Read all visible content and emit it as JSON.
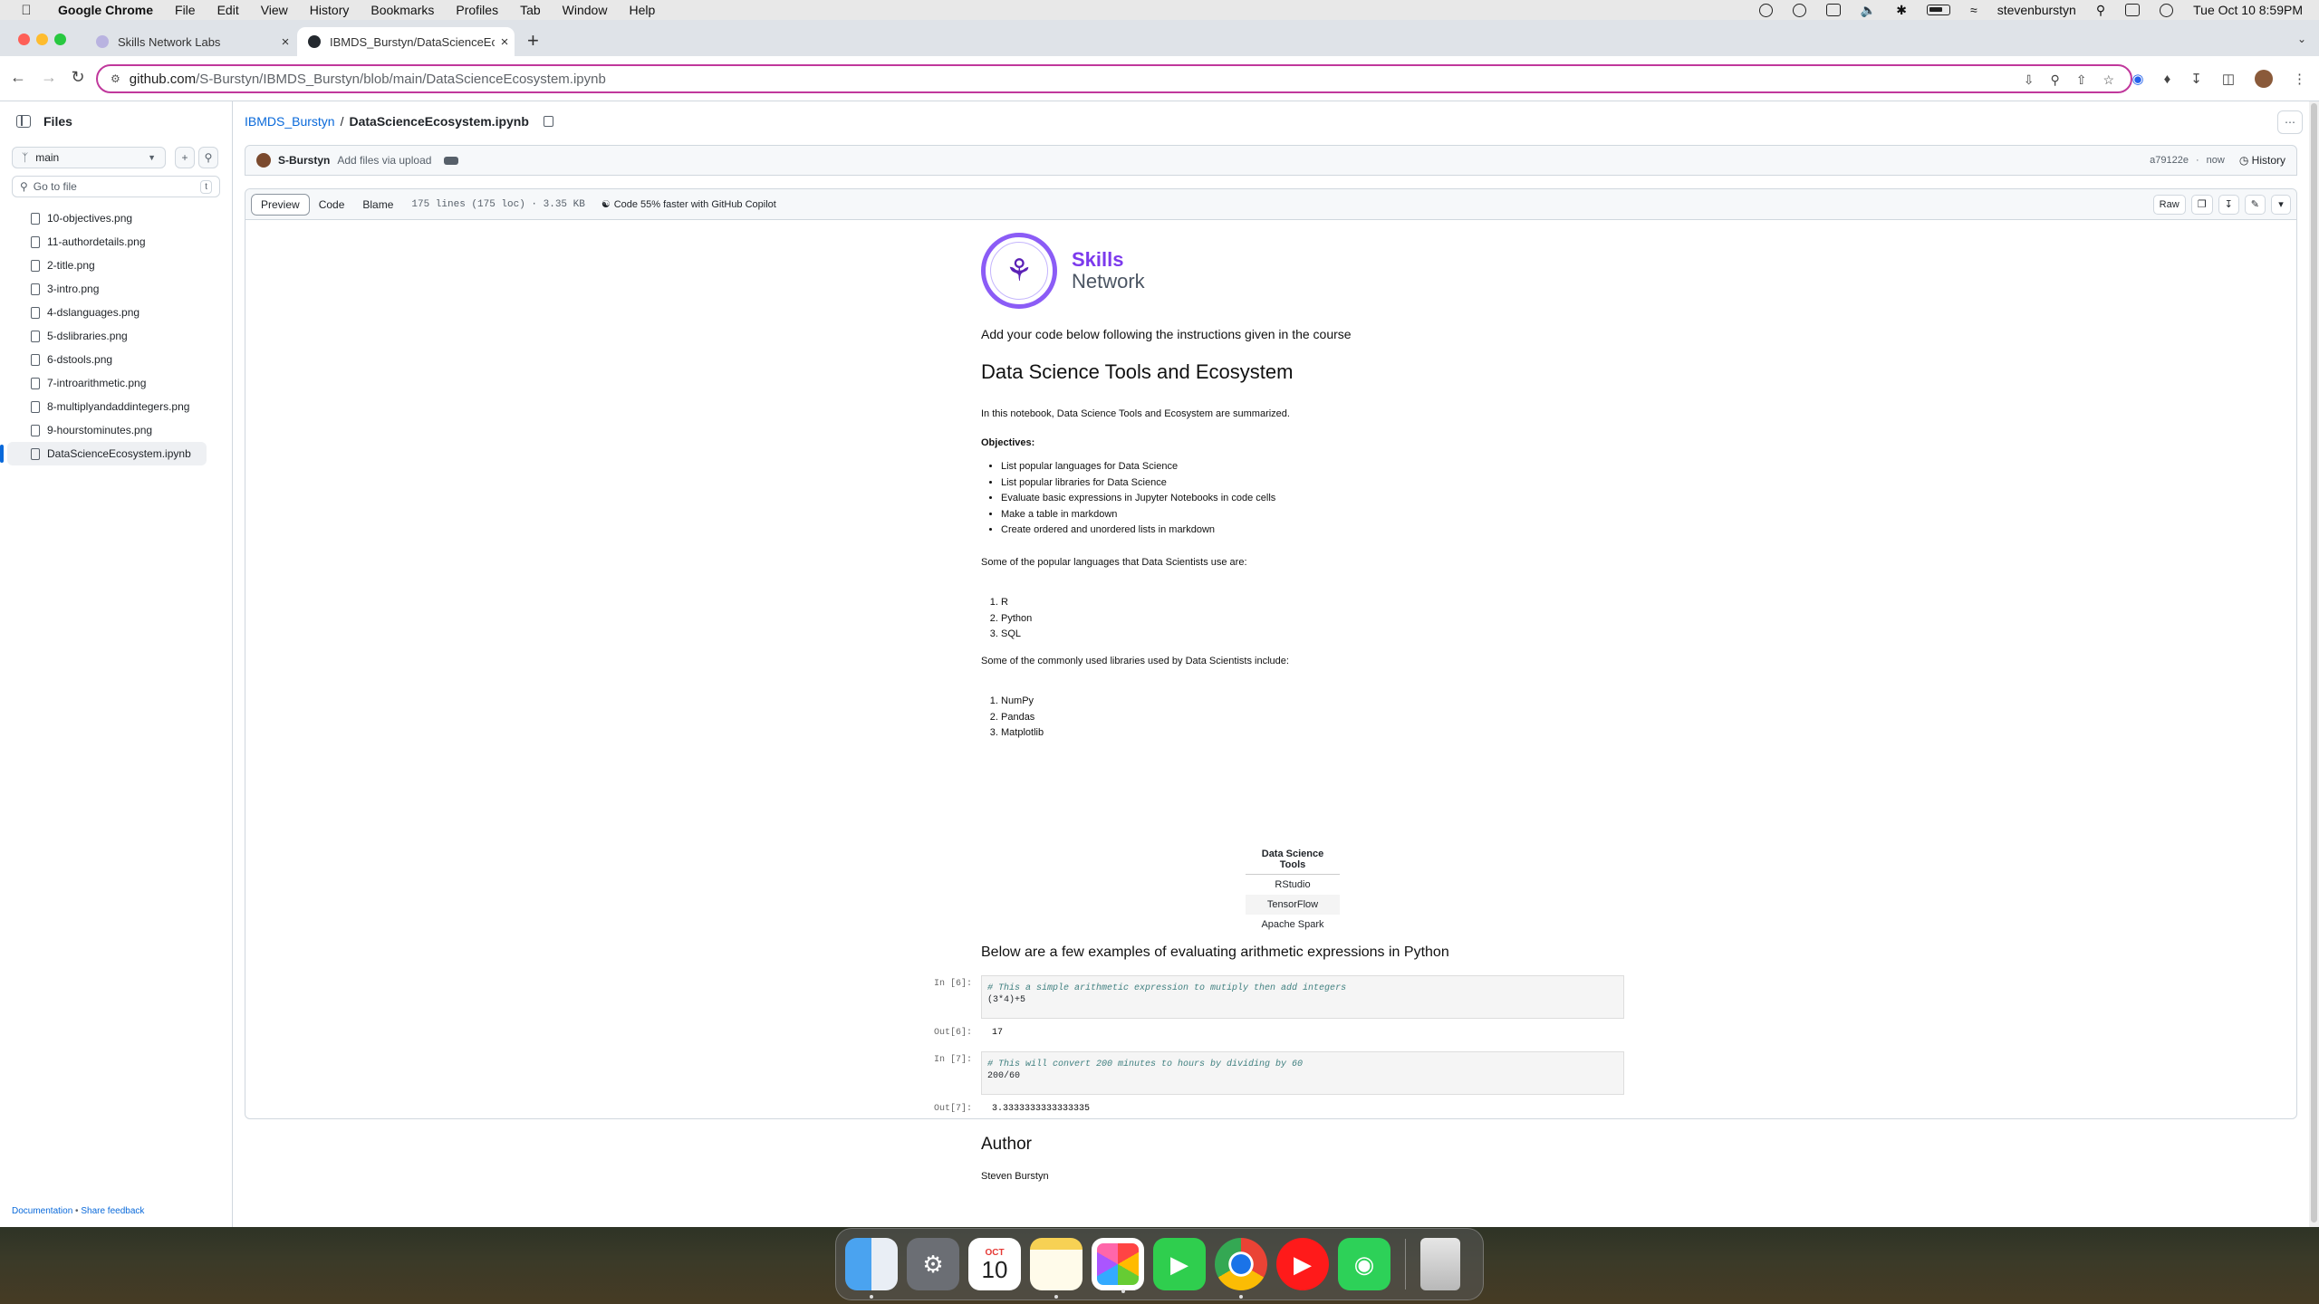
{
  "menubar": {
    "app": "Google Chrome",
    "items": [
      "File",
      "Edit",
      "View",
      "History",
      "Bookmarks",
      "Profiles",
      "Tab",
      "Window",
      "Help"
    ],
    "user": "stevenburstyn",
    "datetime": "Tue Oct 10  8:59PM"
  },
  "browser": {
    "tabs": [
      {
        "title": "Skills Network Labs",
        "active": false
      },
      {
        "title": "IBMDS_Burstyn/DataScienceEcosystem.ipynb",
        "active": true
      }
    ],
    "url_host": "github.com",
    "url_path": "/S-Burstyn/IBMDS_Burstyn/blob/main/DataScienceEcosystem.ipynb"
  },
  "sidebar": {
    "title": "Files",
    "branch": "main",
    "goto_placeholder": "Go to file",
    "goto_kbd": "t",
    "files": [
      "10-objectives.png",
      "11-authordetails.png",
      "2-title.png",
      "3-intro.png",
      "4-dslanguages.png",
      "5-dslibraries.png",
      "6-dstools.png",
      "7-introarithmetic.png",
      "8-multiplyandaddintegers.png",
      "9-hourstominutes.png",
      "DataScienceEcosystem.ipynb"
    ],
    "selected_file": "DataScienceEcosystem.ipynb",
    "footer_docs": "Documentation",
    "footer_sep": "•",
    "footer_feedback": "Share feedback"
  },
  "repo": {
    "owner_repo": "IBMDS_Burstyn",
    "separator": "/",
    "file": "DataScienceEcosystem.ipynb"
  },
  "commit": {
    "user": "S-Burstyn",
    "message": "Add files via upload",
    "hash": "a79122e",
    "sep": "·",
    "time": "now",
    "history": "History"
  },
  "filebar": {
    "tabs": [
      "Preview",
      "Code",
      "Blame"
    ],
    "active_tab": "Preview",
    "meta": "175 lines (175 loc) · 3.35 KB",
    "copilot": "Code 55% faster with GitHub Copilot",
    "raw": "Raw"
  },
  "notebook": {
    "logo_line1": "Skills",
    "logo_line2": "Network",
    "intro_instruction": "Add your code below following the instructions given in the course",
    "title": "Data Science Tools and Ecosystem",
    "summary": "In this notebook, Data Science Tools and Ecosystem are summarized.",
    "objectives_label": "Objectives:",
    "objectives": [
      "List popular languages for Data Science",
      "List popular libraries for Data Science",
      "Evaluate basic expressions in Jupyter Notebooks in code cells",
      "Make a table in markdown",
      "Create ordered and unordered lists in markdown"
    ],
    "languages_intro": "Some of the popular languages that Data Scientists use are:",
    "languages": [
      "R",
      "Python",
      "SQL"
    ],
    "libraries_intro": "Some of the commonly used libraries used by Data Scientists include:",
    "libraries": [
      "NumPy",
      "Pandas",
      "Matplotlib"
    ],
    "tools_header": "Data Science Tools",
    "tools": [
      "RStudio",
      "TensorFlow",
      "Apache Spark"
    ],
    "arith_heading": "Below are a few examples of evaluating arithmetic expressions in Python",
    "cells": [
      {
        "in_prompt": "In [6]:",
        "comment": "# This a simple arithmetic expression to mutiply then add integers",
        "code": "(3*4)+5",
        "out_prompt": "Out[6]:",
        "output": "17"
      },
      {
        "in_prompt": "In [7]:",
        "comment": "# This will convert 200 minutes to hours by dividing by 60",
        "code": "200/60",
        "out_prompt": "Out[7]:",
        "output": "3.3333333333333335"
      }
    ],
    "author_heading": "Author",
    "author_name": "Steven Burstyn"
  },
  "dock": {
    "apps": [
      "Finder",
      "System Settings",
      "Calendar",
      "Notes",
      "Photos",
      "FaceTime",
      "Google Chrome",
      "YouTube",
      "Messages",
      "Trash"
    ],
    "calendar_month": "OCT",
    "calendar_day": "10"
  }
}
